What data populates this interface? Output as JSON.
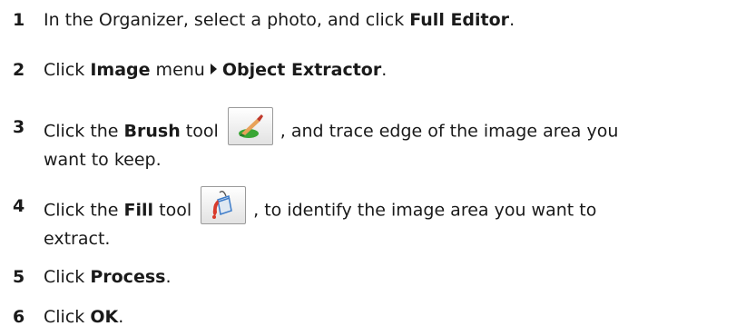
{
  "steps": [
    {
      "num": "1",
      "pre": "In the Organizer, select a photo, and click ",
      "bold": "Full Editor",
      "post": "."
    },
    {
      "num": "2",
      "pre": "Click ",
      "bold1": "Image",
      "mid": " menu",
      "bold2": "Object Extractor",
      "post": "."
    },
    {
      "num": "3",
      "pre": "Click the ",
      "bold": "Brush",
      "mid": " tool",
      "post": ", and trace edge of the image area you",
      "cont": "want to keep.",
      "icon": "brush-tool-icon"
    },
    {
      "num": "4",
      "pre": "Click the ",
      "bold": "Fill",
      "mid": " tool",
      "post": ", to identify the image area you want to",
      "cont": "extract.",
      "icon": "fill-tool-icon"
    },
    {
      "num": "5",
      "pre": "Click ",
      "bold": "Process",
      "post": "."
    },
    {
      "num": "6",
      "pre": "Click ",
      "bold": "OK",
      "post": "."
    }
  ],
  "colors": {
    "text": "#1a1a1a",
    "brush_tip": "#c0392b",
    "brush_handle": "#e8a25a",
    "paint_green": "#3aa635",
    "bucket_red": "#d93b2b",
    "bucket_blue": "#3d7cc9"
  }
}
